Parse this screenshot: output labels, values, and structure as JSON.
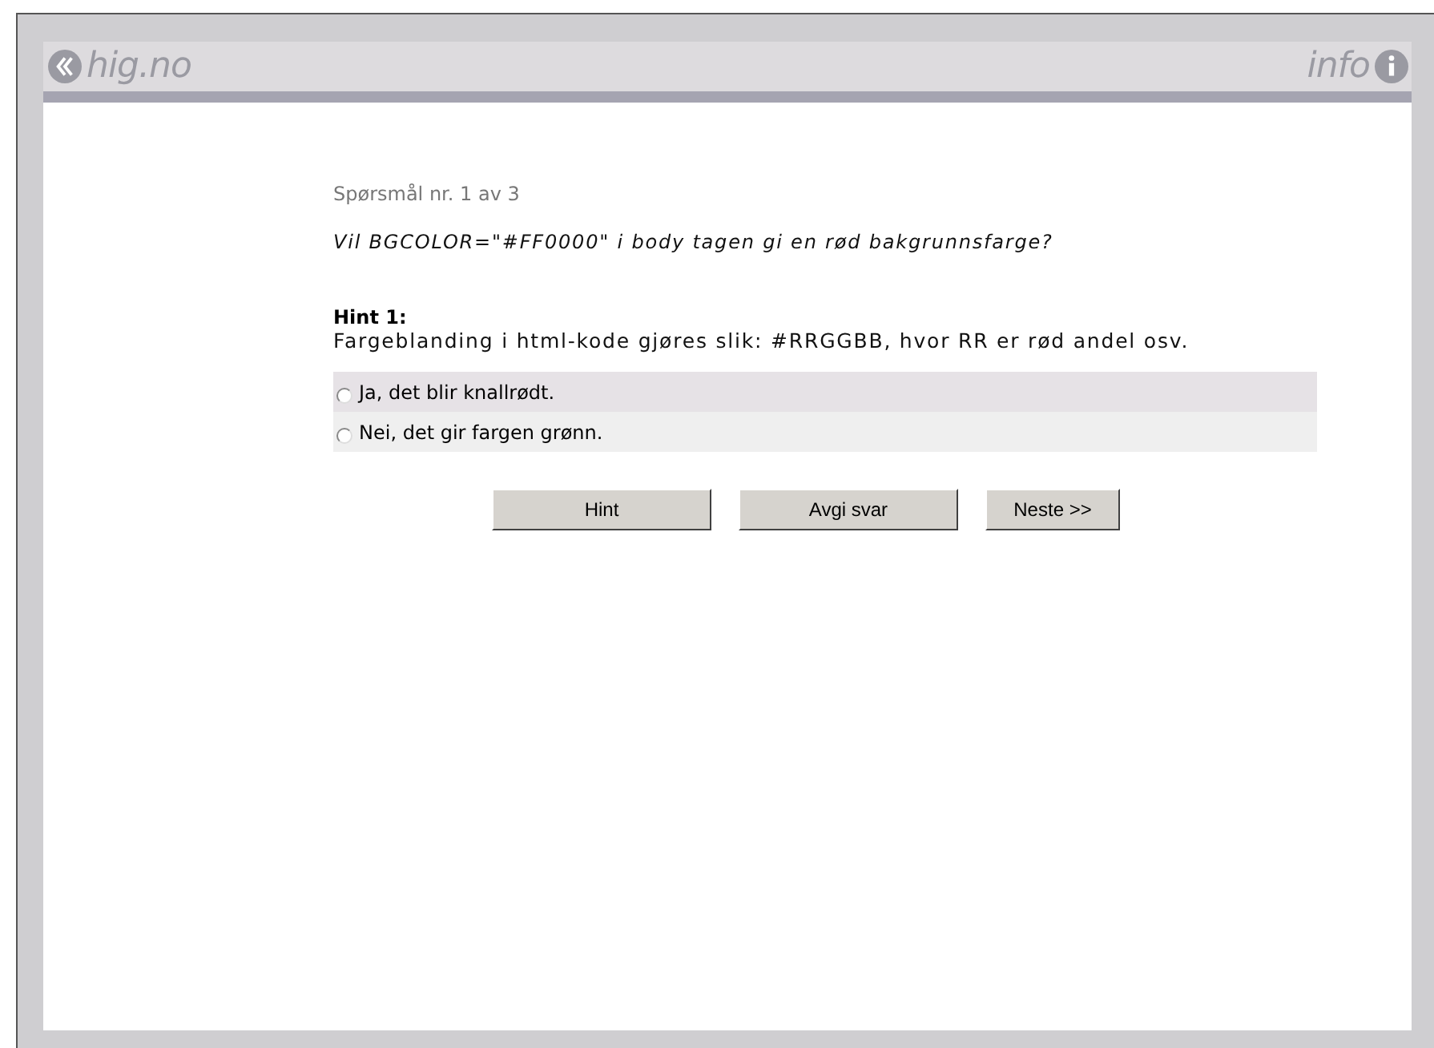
{
  "header": {
    "logo": "hig.no",
    "info": "info"
  },
  "question": {
    "counter": "Spørsmål nr. 1 av 3",
    "text": "Vil BGCOLOR=\"#FF0000\" i body tagen gi en rød bakgrunnsfarge?"
  },
  "hint": {
    "title": "Hint 1:",
    "text": "Fargeblanding i html-kode gjøres slik: #RRGGBB, hvor RR er rød andel osv."
  },
  "options": [
    {
      "label": "Ja, det blir knallrødt.",
      "selected": false
    },
    {
      "label": "Nei, det gir fargen grønn.",
      "selected": false
    }
  ],
  "buttons": [
    "Hint",
    "Avgi svar",
    "Neste >>"
  ]
}
